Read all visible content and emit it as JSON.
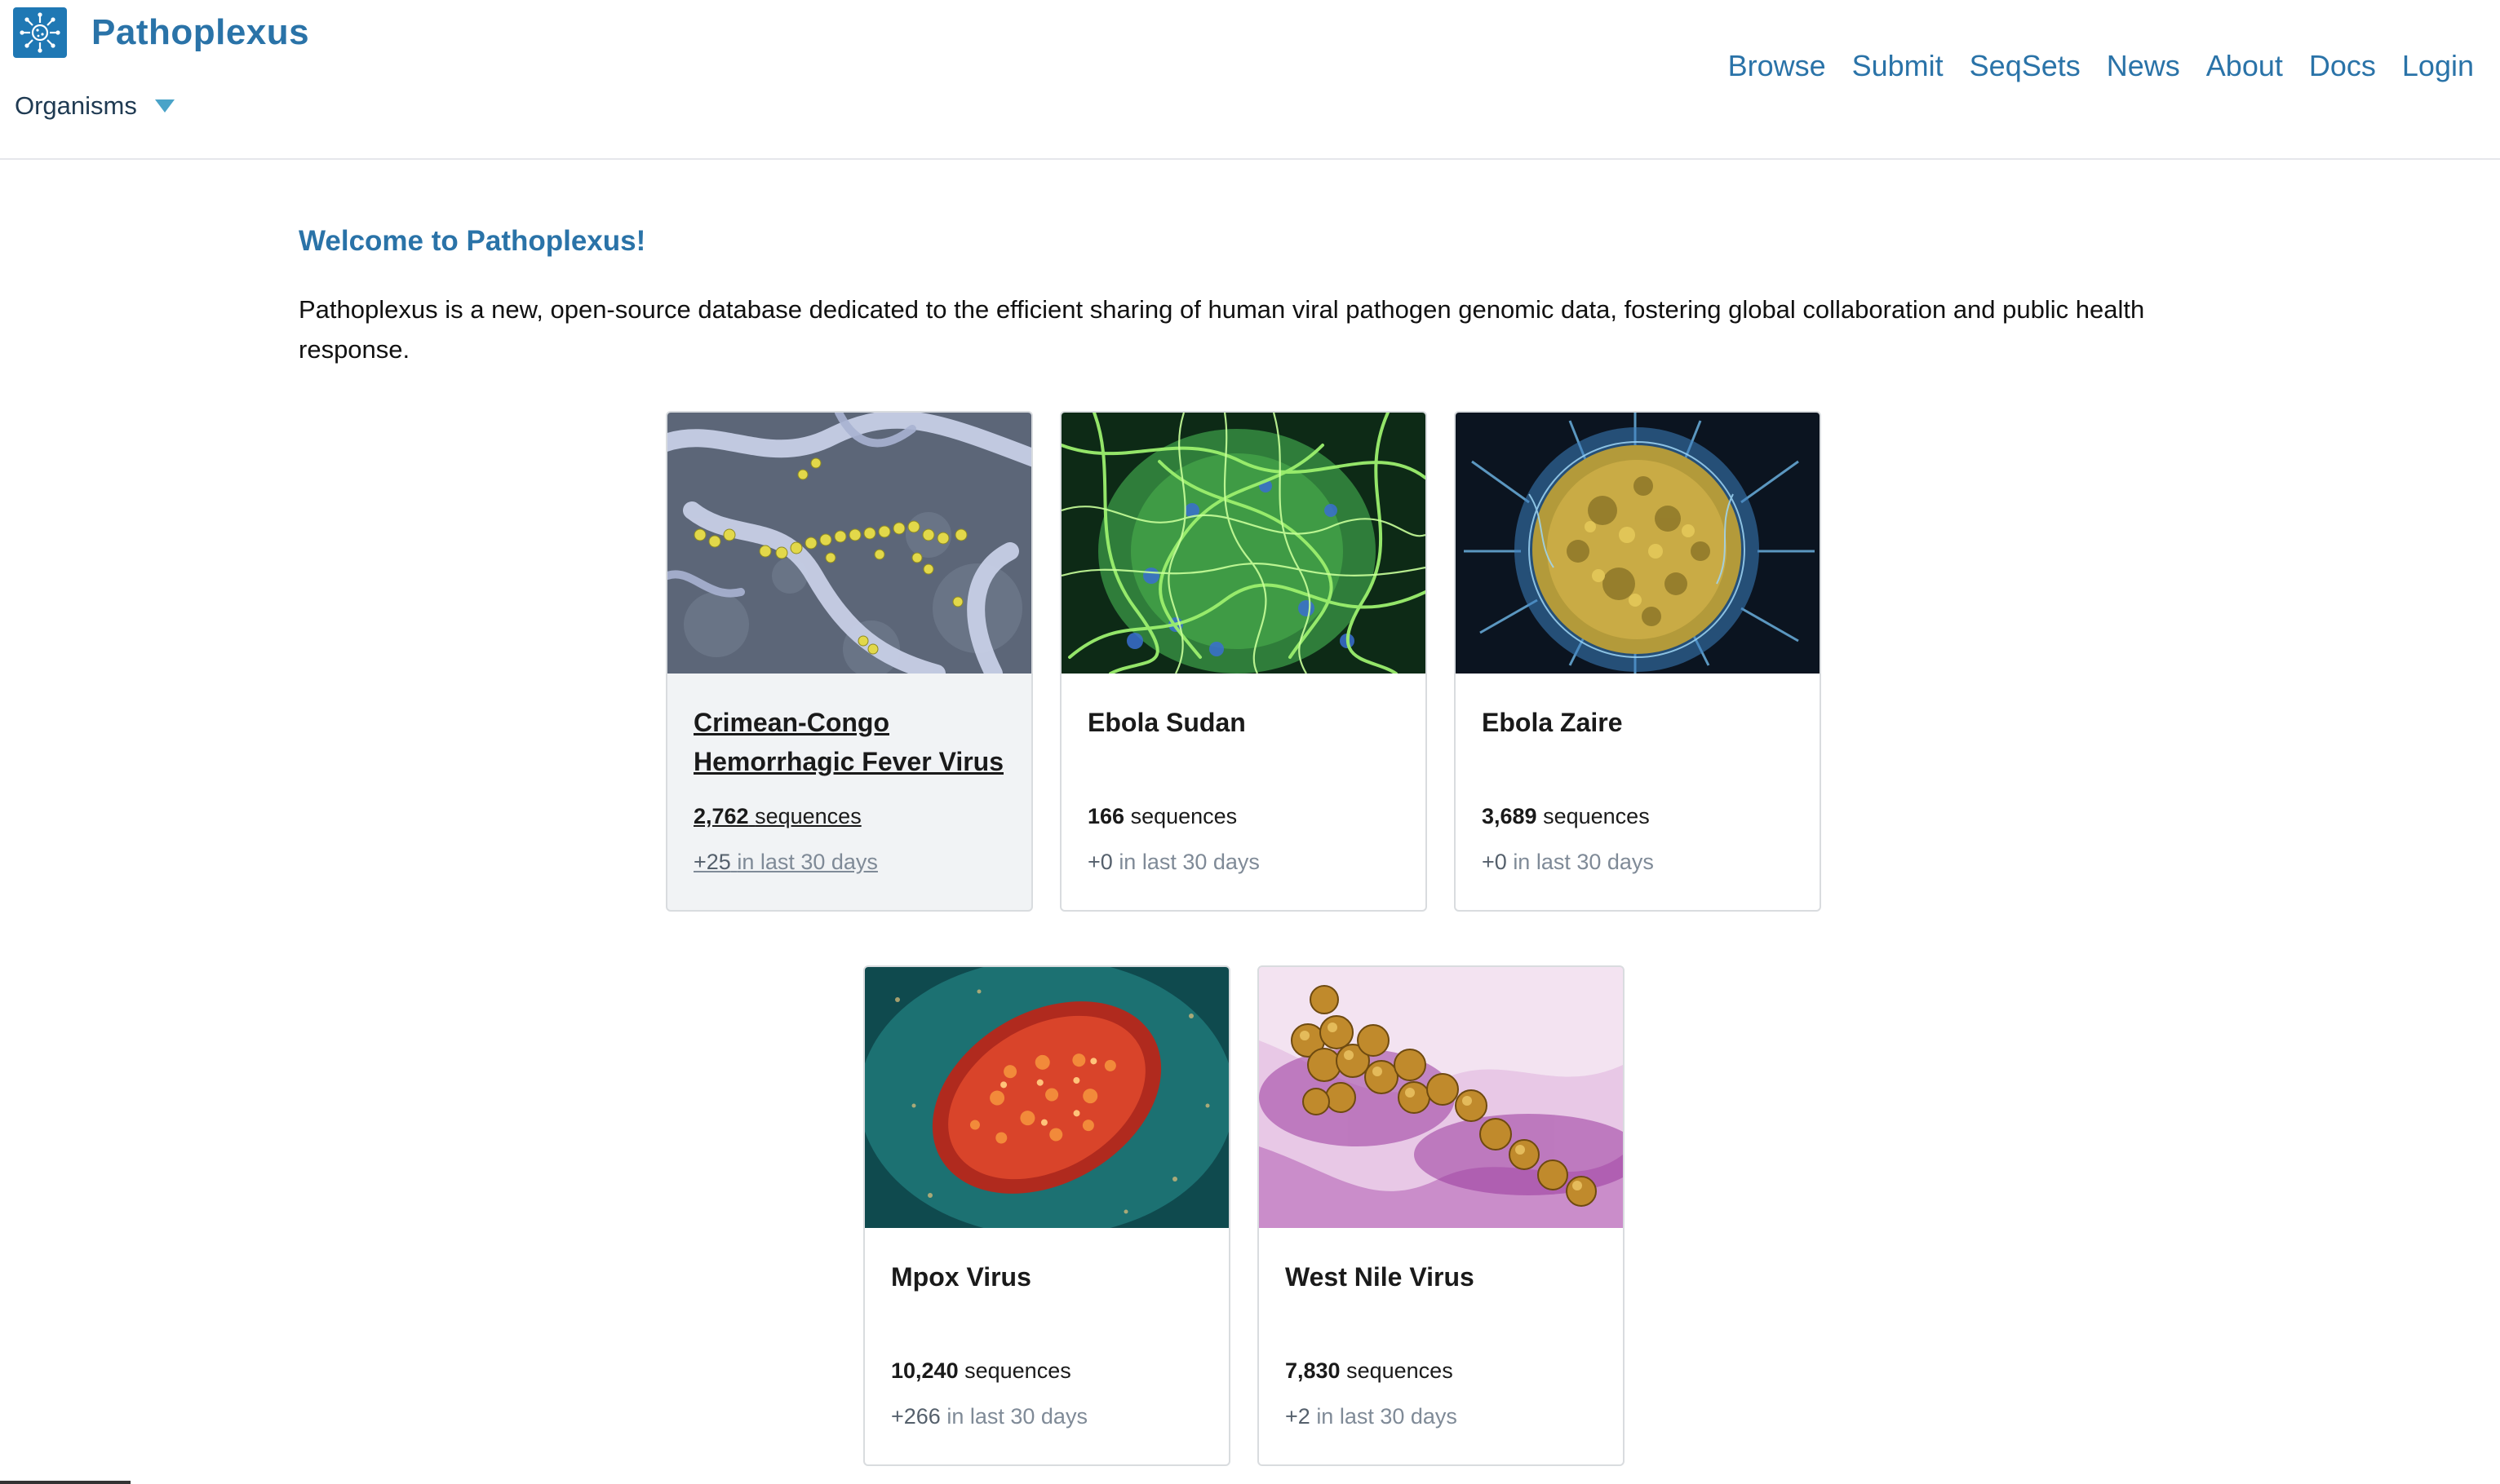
{
  "app": {
    "name": "Pathoplexus",
    "organisms_label": "Organisms"
  },
  "nav": {
    "items": [
      {
        "label": "Browse"
      },
      {
        "label": "Submit"
      },
      {
        "label": "SeqSets"
      },
      {
        "label": "News"
      },
      {
        "label": "About"
      },
      {
        "label": "Docs"
      },
      {
        "label": "Login"
      }
    ]
  },
  "main": {
    "welcome": "Welcome to Pathoplexus!",
    "intro": "Pathoplexus is a new, open-source database dedicated to the efficient sharing of human viral pathogen genomic data, fostering global collaboration and public health response."
  },
  "cards": [
    {
      "title": "Crimean-Congo Hemorrhagic Fever Virus",
      "count": "2,762",
      "count_label": "sequences",
      "recent": "+25",
      "recent_label": "in last 30 days"
    },
    {
      "title": "Ebola Sudan",
      "count": "166",
      "count_label": "sequences",
      "recent": "+0",
      "recent_label": "in last 30 days"
    },
    {
      "title": "Ebola Zaire",
      "count": "3,689",
      "count_label": "sequences",
      "recent": "+0",
      "recent_label": "in last 30 days"
    },
    {
      "title": "Mpox Virus",
      "count": "10,240",
      "count_label": "sequences",
      "recent": "+266",
      "recent_label": "in last 30 days"
    },
    {
      "title": "West Nile Virus",
      "count": "7,830",
      "count_label": "sequences",
      "recent": "+2",
      "recent_label": "in last 30 days"
    }
  ],
  "colors": {
    "brand": "#2a73a8",
    "logo_bg": "#1f78b4",
    "caret": "#4aa3c8",
    "muted": "#7f8a97"
  },
  "icons": {
    "logo": "virus-logo-icon",
    "organisms_dropdown": "caret-down-icon"
  }
}
